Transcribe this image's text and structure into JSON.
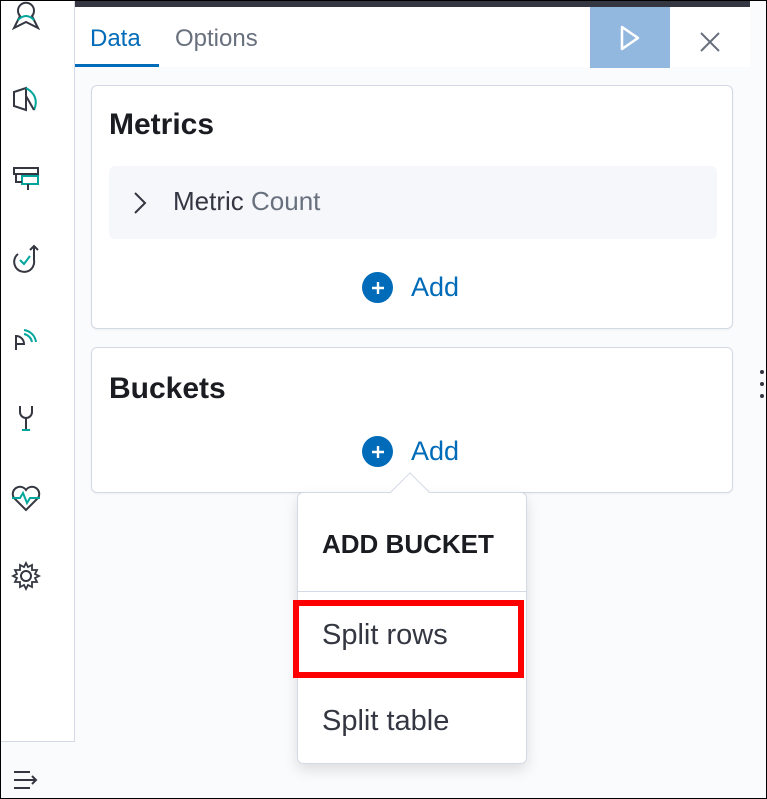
{
  "tabs": [
    {
      "label": "Data",
      "active": true
    },
    {
      "label": "Options",
      "active": false
    }
  ],
  "metrics": {
    "title": "Metrics",
    "row_name": "Metric",
    "row_value": "Count",
    "add_label": "Add"
  },
  "buckets": {
    "title": "Buckets",
    "add_label": "Add"
  },
  "popover": {
    "title": "ADD BUCKET",
    "items": [
      "Split rows",
      "Split table"
    ],
    "highlighted": "Split rows"
  },
  "nav_icons": [
    "maps-icon",
    "canvas-icon",
    "monitoring-icon",
    "uptime-icon",
    "apm-icon",
    "dev-tools-icon",
    "heartbeat-icon",
    "settings-icon"
  ],
  "colors": {
    "accent": "#006bb8",
    "run_button": "#92b8df",
    "highlight": "#ff0000",
    "nav_icon": "#006c5e"
  }
}
